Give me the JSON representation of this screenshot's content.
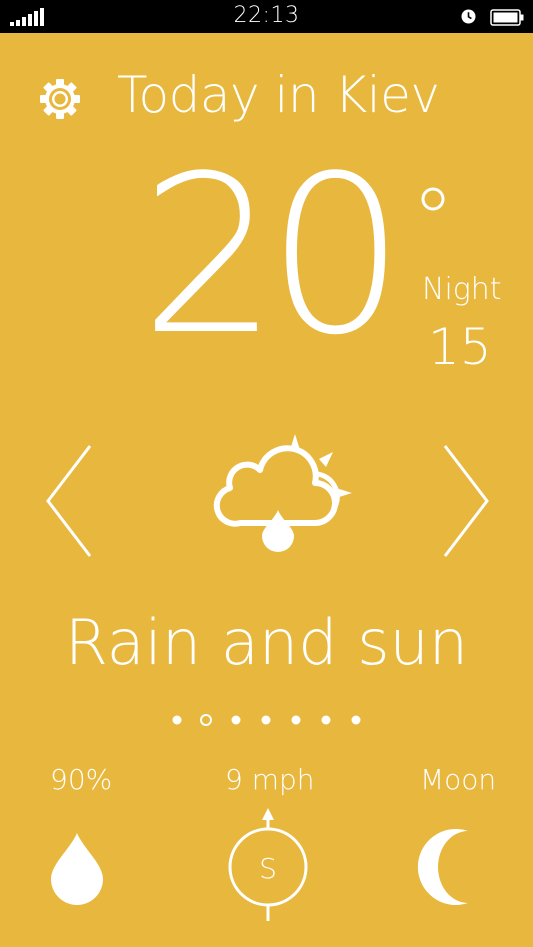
{
  "status_bar": {
    "time": "22:13",
    "icons": [
      "signal-icon",
      "alarm-clock-icon",
      "battery-icon"
    ]
  },
  "header": {
    "title": "Today in Kiev",
    "settings_icon": "gear-icon"
  },
  "current": {
    "temperature": "20",
    "degree_symbol": "°",
    "night_label": "Night",
    "night_value": "15"
  },
  "condition": {
    "text": "Rain and sun",
    "icon": "cloud-rain-sun-icon"
  },
  "navigation": {
    "prev_icon": "chevron-left-icon",
    "next_icon": "chevron-right-icon",
    "page_count": 7,
    "active_page_index": 1
  },
  "stats": {
    "humidity": {
      "label": "90%",
      "icon": "raindrop-icon"
    },
    "wind": {
      "label": "9 mph",
      "direction": "S",
      "icon": "compass-icon"
    },
    "moon": {
      "label": "Moon",
      "icon": "moon-icon"
    }
  },
  "colors": {
    "background": "#E8B73E",
    "foreground": "#FFFFFF",
    "status_bar": "#000000"
  }
}
